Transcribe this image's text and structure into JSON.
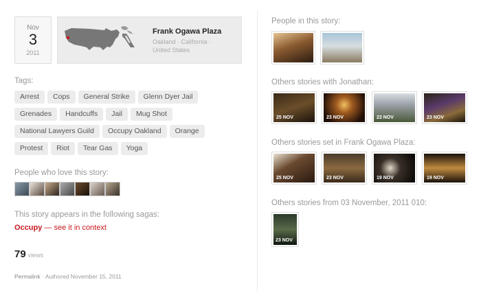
{
  "date": {
    "month": "Nov",
    "day": "3",
    "year": "2011"
  },
  "place": {
    "name": "Frank Ogawa Plaza",
    "sub": "Oakland · California · United States"
  },
  "tags_title": "Tags:",
  "tags": [
    "Arrest",
    "Cops",
    "General Strike",
    "Glenn Dyer Jail",
    "Grenades",
    "Handcuffs",
    "Jail",
    "Mug Shot",
    "National Lawyers Guild",
    "Occupy Oakland",
    "Orange",
    "Protest",
    "Riot",
    "Tear Gas",
    "Yoga"
  ],
  "love_title": "People who love this story:",
  "saga_title": "This story appears in the following sagas:",
  "saga": {
    "name": "Occupy",
    "link": "— see it in context"
  },
  "views": {
    "count": "79",
    "label": "views"
  },
  "meta": {
    "permalink": "Permalink",
    "authored": "· Authored November 15, 2011"
  },
  "right": {
    "people_title": "People in this story:",
    "jonathan_title": "Others stories with Jonathan:",
    "jonathan_dates": [
      "25 NOV",
      "23 NOV",
      "23 NOV",
      "23 NOV"
    ],
    "plaza_title": "Others stories set in Frank Ogawa Plaza:",
    "plaza_dates": [
      "25 NOV",
      "23 NOV",
      "19 NOV",
      "19 NOV"
    ],
    "day_title": "Others stories from 03 November, 2011 010:",
    "day_dates": [
      "23 NOV"
    ]
  },
  "colors": {
    "accent": "#c8171e",
    "tag_bg": "#ececec",
    "muted_text": "#999999"
  }
}
